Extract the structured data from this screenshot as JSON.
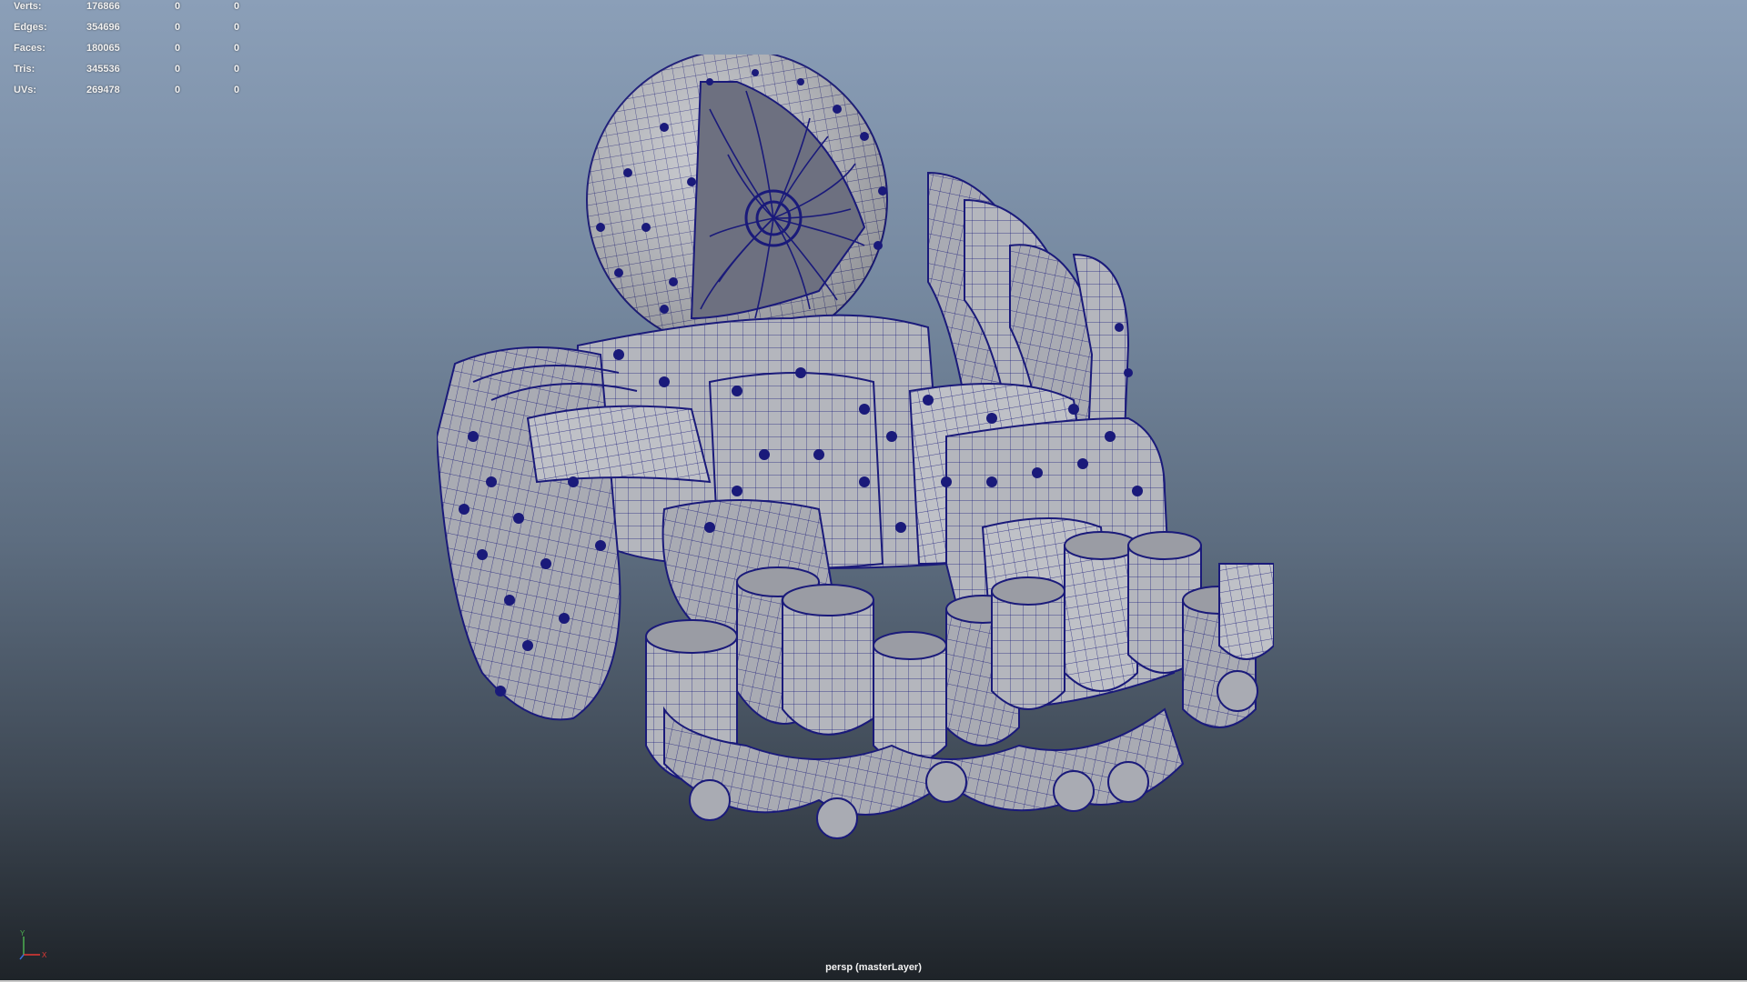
{
  "heads_up_display": {
    "rows": [
      {
        "label": "Verts:",
        "count": "176866",
        "selected": "0",
        "uv_selected": "0"
      },
      {
        "label": "Edges:",
        "count": "354696",
        "selected": "0",
        "uv_selected": "0"
      },
      {
        "label": "Faces:",
        "count": "180065",
        "selected": "0",
        "uv_selected": "0"
      },
      {
        "label": "Tris:",
        "count": "345536",
        "selected": "0",
        "uv_selected": "0"
      },
      {
        "label": "UVs:",
        "count": "269478",
        "selected": "0",
        "uv_selected": "0"
      }
    ]
  },
  "viewport": {
    "camera_label": "persp (masterLayer)",
    "axis_labels": {
      "y": "Y",
      "x": "X"
    },
    "model": "wireframe-on-shaded-cell-organelle-model",
    "wire_color": "#1a1a7a",
    "shade_color": "#b4b6bd"
  }
}
